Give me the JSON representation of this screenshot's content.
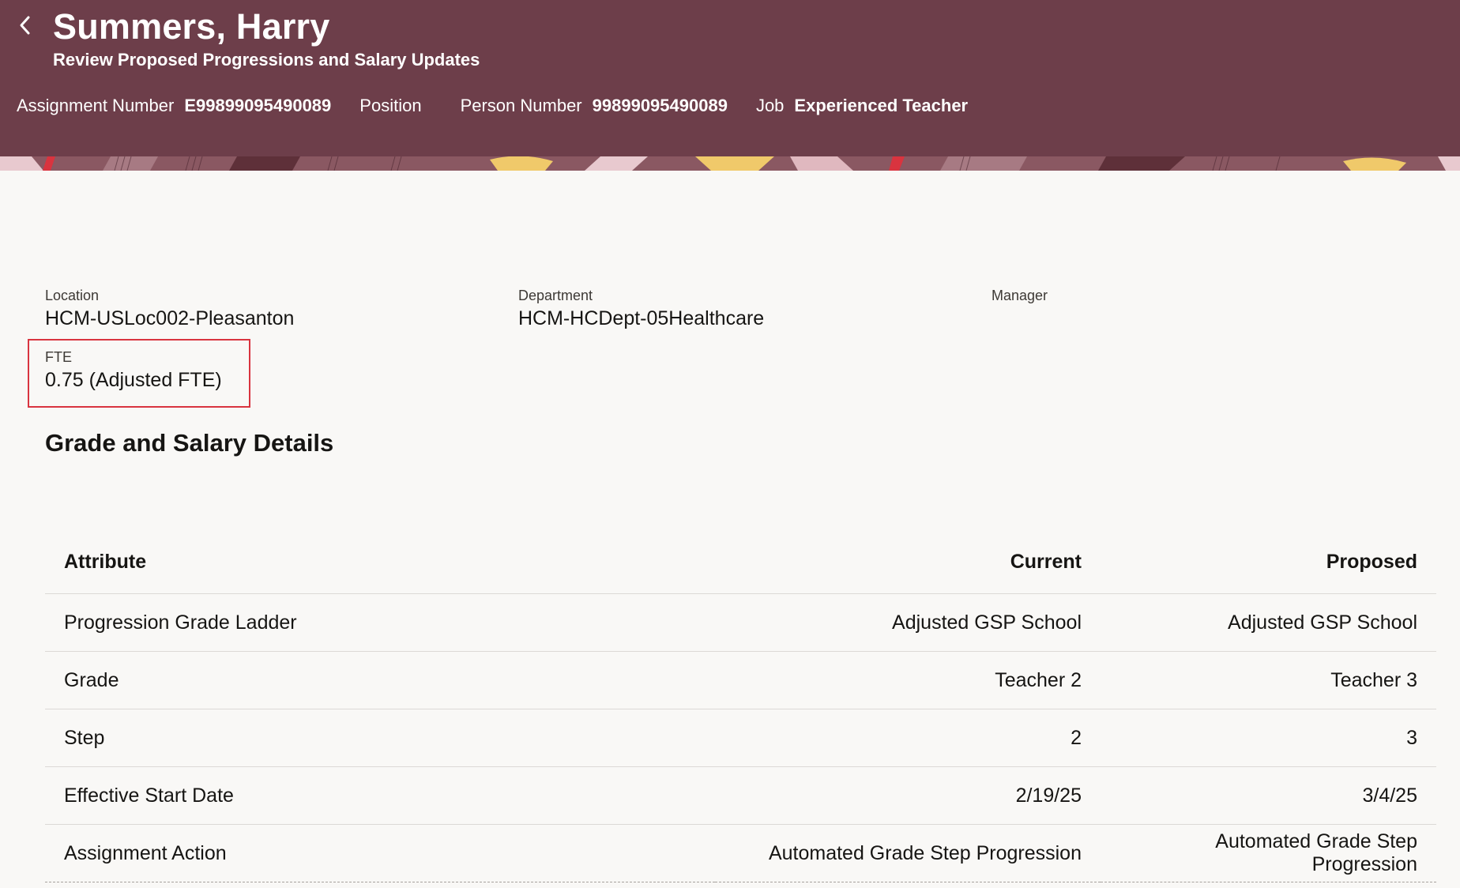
{
  "header": {
    "title": "Summers, Harry",
    "subtitle": "Review Proposed Progressions and Salary Updates",
    "meta": [
      {
        "label": "Assignment Number",
        "value": "E99899095490089"
      },
      {
        "label": "Position",
        "value": ""
      },
      {
        "label": "Person Number",
        "value": "99899095490089"
      },
      {
        "label": "Job",
        "value": "Experienced Teacher"
      }
    ]
  },
  "details": {
    "location_label": "Location",
    "location_value": "HCM-USLoc002-Pleasanton",
    "department_label": "Department",
    "department_value": "HCM-HCDept-05Healthcare",
    "manager_label": "Manager",
    "manager_value": "",
    "fte_label": "FTE",
    "fte_value": "0.75 (Adjusted FTE)"
  },
  "section_title": "Grade and Salary Details",
  "table": {
    "headers": [
      "Attribute",
      "Current",
      "Proposed"
    ],
    "rows": [
      [
        "Progression Grade Ladder",
        "Adjusted GSP School",
        "Adjusted GSP School"
      ],
      [
        "Grade",
        "Teacher 2",
        "Teacher 3"
      ],
      [
        "Step",
        "2",
        "3"
      ],
      [
        "Effective Start Date",
        "2/19/25",
        "3/4/25"
      ],
      [
        "Assignment Action",
        "Automated Grade Step Progression",
        "Automated Grade Step Progression"
      ]
    ]
  },
  "colors": {
    "header_bg": "#6d3e4a",
    "highlight_border": "#d9343f",
    "page_bg": "#f9f8f6"
  },
  "icons": {
    "back": "chevron-left-icon"
  }
}
